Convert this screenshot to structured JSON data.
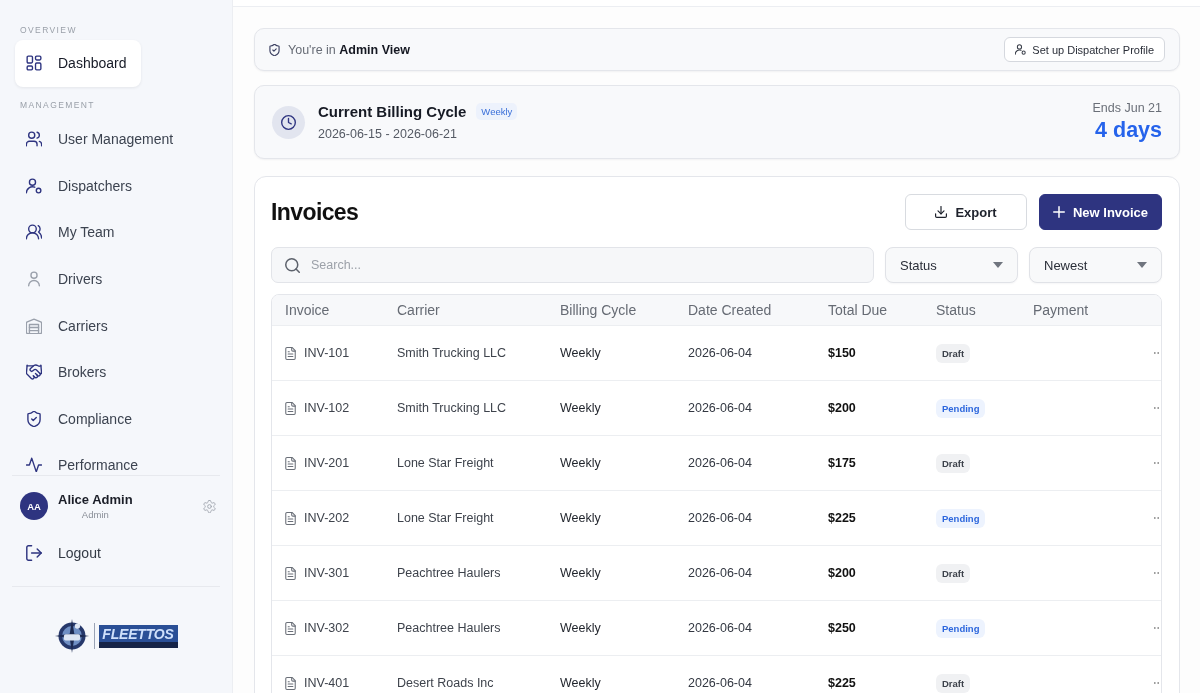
{
  "sidebar": {
    "sections": [
      {
        "label": "OVERVIEW",
        "items": [
          {
            "label": "Dashboard",
            "selected": true
          }
        ]
      },
      {
        "label": "MANAGEMENT",
        "items": [
          {
            "label": "User Management",
            "selected": false
          },
          {
            "label": "Dispatchers",
            "selected": false
          },
          {
            "label": "My Team",
            "selected": false
          },
          {
            "label": "Drivers",
            "selected": false
          },
          {
            "label": "Carriers",
            "selected": false
          },
          {
            "label": "Brokers",
            "selected": false
          },
          {
            "label": "Compliance",
            "selected": false
          },
          {
            "label": "Performance",
            "selected": false
          }
        ]
      }
    ],
    "user": {
      "initials": "AA",
      "name": "Alice Admin",
      "role": "Admin"
    },
    "logout": "Logout",
    "logo": "FLEETTOS"
  },
  "admin_banner": {
    "text": "You're in **Admin View**",
    "button": "Set up Dispatcher Profile"
  },
  "billing_cycle": {
    "title": "Current Billing Cycle",
    "badge": "Weekly",
    "range": "2026-06-15 - 2026-06-21",
    "ends": "Ends Jun 21",
    "remaining": "4 days"
  },
  "invoices": {
    "title": "Invoices",
    "buttons": [
      {
        "label": "Export",
        "kind": "secondary"
      },
      {
        "label": "New Invoice",
        "kind": "primary"
      }
    ],
    "search": {
      "placeholder": "Search..."
    },
    "filters": [
      "Status",
      "Newest"
    ],
    "table": {
      "columns": [
        "Invoice",
        "Carrier",
        "Billing Cycle",
        "Date Created",
        "Total Due",
        "Status",
        "Payment"
      ],
      "rows": [
        {
          "invoice": "INV-101",
          "carrier": "Smith Trucking LLC",
          "billing_cycle": "Weekly",
          "date_created": "2026-06-04",
          "total_due": "$150",
          "status": {
            "label": "Draft",
            "kind": "draft"
          }
        },
        {
          "invoice": "INV-102",
          "carrier": "Smith Trucking LLC",
          "billing_cycle": "Weekly",
          "date_created": "2026-06-04",
          "total_due": "$200",
          "status": {
            "label": "Pending",
            "kind": "pending"
          }
        },
        {
          "invoice": "INV-201",
          "carrier": "Lone Star Freight",
          "billing_cycle": "Weekly",
          "date_created": "2026-06-04",
          "total_due": "$175",
          "status": {
            "label": "Draft",
            "kind": "draft"
          }
        },
        {
          "invoice": "INV-202",
          "carrier": "Lone Star Freight",
          "billing_cycle": "Weekly",
          "date_created": "2026-06-04",
          "total_due": "$225",
          "status": {
            "label": "Pending",
            "kind": "pending"
          }
        },
        {
          "invoice": "INV-301",
          "carrier": "Peachtree Haulers",
          "billing_cycle": "Weekly",
          "date_created": "2026-06-04",
          "total_due": "$200",
          "status": {
            "label": "Draft",
            "kind": "draft"
          }
        },
        {
          "invoice": "INV-302",
          "carrier": "Peachtree Haulers",
          "billing_cycle": "Weekly",
          "date_created": "2026-06-04",
          "total_due": "$250",
          "status": {
            "label": "Pending",
            "kind": "pending"
          }
        },
        {
          "invoice": "INV-401",
          "carrier": "Desert Roads Inc",
          "billing_cycle": "Weekly",
          "date_created": "2026-06-04",
          "total_due": "$225",
          "status": {
            "label": "Draft",
            "kind": "draft"
          }
        }
      ]
    }
  }
}
